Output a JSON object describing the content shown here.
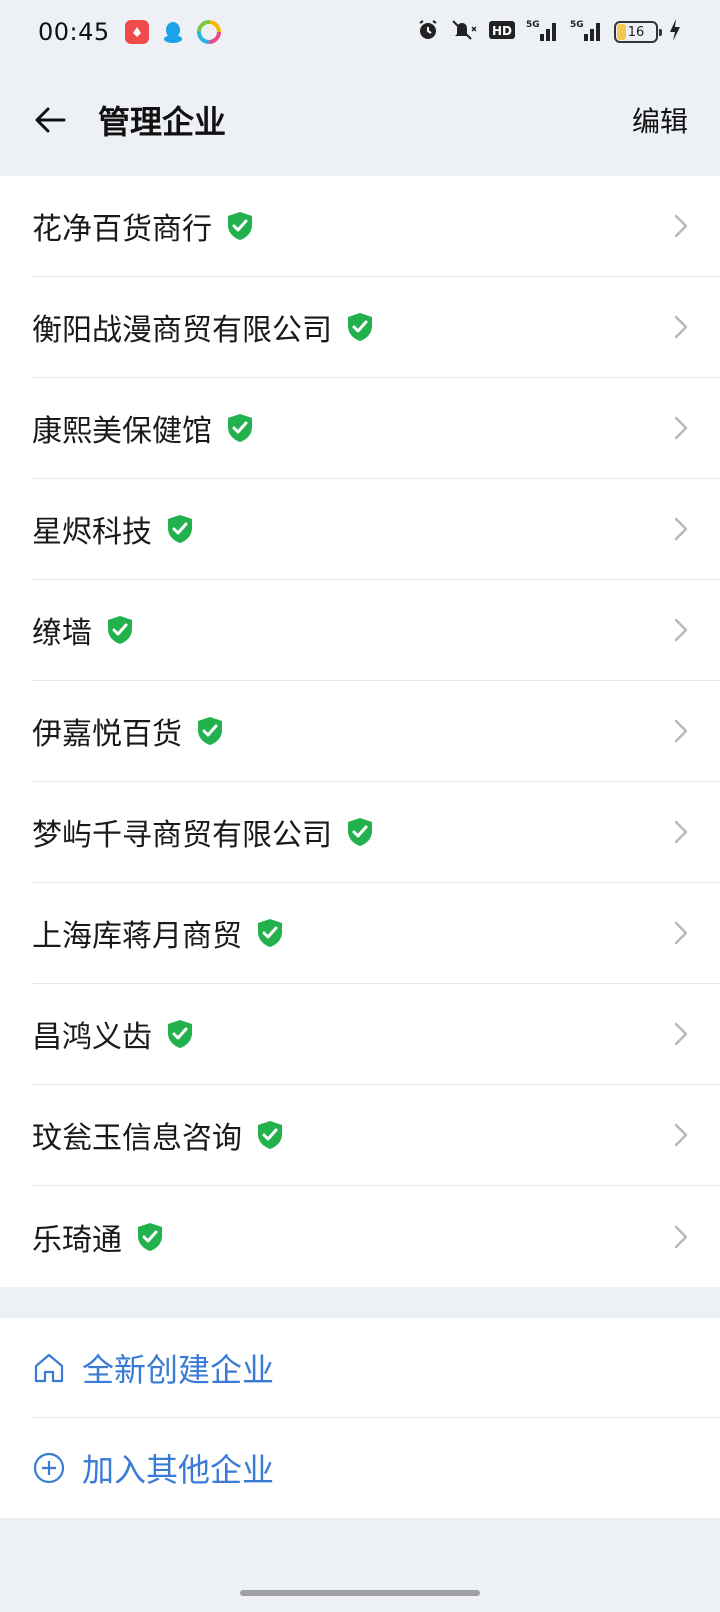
{
  "status_bar": {
    "time": "00:45",
    "battery": "16",
    "signal_1": "5G",
    "signal_2": "5G",
    "hd": "HD"
  },
  "header": {
    "title": "管理企业",
    "edit_label": "编辑"
  },
  "companies": [
    {
      "name": "花净百货商行"
    },
    {
      "name": "衡阳战漫商贸有限公司"
    },
    {
      "name": "康熙美保健馆"
    },
    {
      "name": "星烬科技"
    },
    {
      "name": "缭墙"
    },
    {
      "name": "伊嘉悦百货"
    },
    {
      "name": "梦屿千寻商贸有限公司"
    },
    {
      "name": "上海库蒋月商贸"
    },
    {
      "name": "昌鸿义齿"
    },
    {
      "name": "玟瓮玉信息咨询"
    },
    {
      "name": "乐琦通"
    }
  ],
  "actions": {
    "create_label": "全新创建企业",
    "join_label": "加入其他企业"
  },
  "colors": {
    "accent": "#3a7bd5",
    "verified": "#22b14c",
    "background": "#edf0f5"
  }
}
